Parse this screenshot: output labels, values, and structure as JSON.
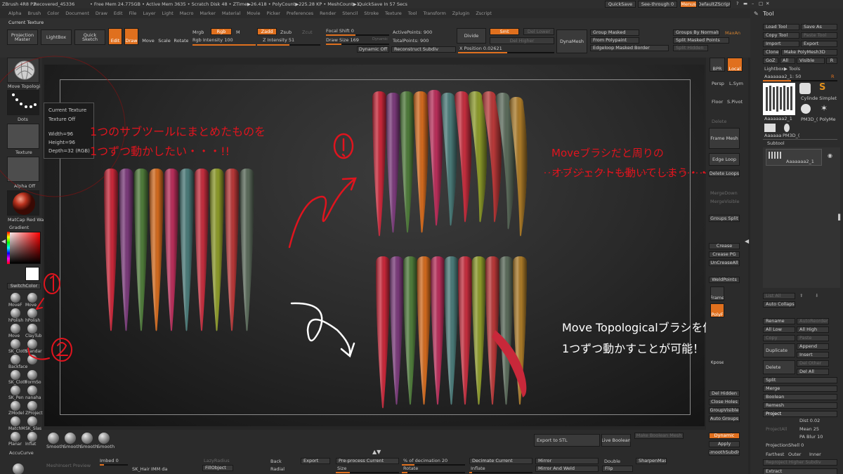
{
  "topbar": {
    "title": "ZBrush 4R8 P2",
    "file": "Recovered_45336",
    "stats": "• Free Mem 24.775GB • Active Mem 3635 • Scratch Disk 48 • ZTime▶26.418 • PolyCount▶225.28 KP • MeshCount▶1",
    "quicksave_note": "QuickSave In 57 Secs",
    "quicksave": "QuickSave",
    "seethrough": "See-through  0",
    "menus": "Menus",
    "defaultzscript": "DefaultZScript"
  },
  "menu": [
    "Alpha",
    "Brush",
    "Color",
    "Document",
    "Draw",
    "Edit",
    "File",
    "Layer",
    "Light",
    "Macro",
    "Marker",
    "Material",
    "Movie",
    "Picker",
    "Preferences",
    "Render",
    "Stencil",
    "Stroke",
    "Texture",
    "Tool",
    "Transform",
    "Zplugin",
    "Zscript"
  ],
  "shelf": {
    "current_texture": "Current Texture",
    "projection_master": "Projection Master",
    "lightbox": "LightBox",
    "quick_sketch": "Quick Sketch",
    "edit": "Edit",
    "draw": "Draw",
    "move": "Move",
    "scale": "Scale",
    "rotate": "Rotate",
    "mrgb": "Mrgb",
    "rgb": "Rgb",
    "m": "M",
    "rgb_intensity": "Rgb Intensity 100",
    "zadd": "Zadd",
    "zsub": "Zsub",
    "zcut": "Zcut",
    "z_intensity": "Z Intensity 51",
    "focal_shift": "Focal Shift 0",
    "draw_size": "Draw Size 169",
    "dynamic_small": "Dynamic",
    "dynamic_off": "Dynamic Off",
    "active_points": "ActivePoints: 900",
    "total_points": "TotalPoints: 900",
    "reconstruct_subdiv": "Reconstruct Subdiv",
    "divide": "Divide",
    "smt": "Smt",
    "del_lower": "Del Lower",
    "del_higher": "Del Higher",
    "x_position": "X Position 0.02621",
    "dynamesh": "DynaMesh",
    "group_masked": "Group Masked",
    "from_polypaint": "From Polypaint",
    "edgeloop_masked_border": "Edgeloop Masked Border",
    "groups_by_normals": "Groups By Normals",
    "maxan": "MaxAn",
    "split_masked_points": "Split Masked Points",
    "split_hidden": "Split Hidden"
  },
  "left": {
    "brush_thumb": "Move Topologi",
    "stroke_thumb": "Dots",
    "texture_thumb": "Texture",
    "alpha_thumb": "Alpha Off",
    "material_thumb": "MatCap Red Wa",
    "gradient": "Gradient",
    "switchcolor": "SwitchColor",
    "brushes": [
      "MoveF",
      "Move",
      "hPolish",
      "hPolish",
      "Move",
      "ClayTub",
      "SK_Cloth",
      "Standar",
      "Backface",
      "",
      "SK_Cloth",
      "FormSo",
      "SK_Pen",
      "nanaha",
      "ZModel",
      "ZProject",
      "MatchM",
      "SK_Slas",
      "Planar",
      "Inflat"
    ],
    "accucurve": "AccuCurve",
    "tooltip_title": "Current Texture",
    "tooltip_state": "Texture Off",
    "tooltip_width": "Width=96",
    "tooltip_height": "Height=96",
    "tooltip_depth": "Depth=32 (RGB)"
  },
  "rightshelf": {
    "bpr": "BPR",
    "local": "Local",
    "persp": "Persp",
    "lsym": "L.Sym",
    "floor": "Floor",
    "spivot": "S.Pivot",
    "delete": "Delete",
    "frame_mesh": "Frame Mesh",
    "edge_loop": "Edge Loop",
    "delete_loops": "Delete Loops",
    "merge_down": "MergeDown",
    "merge_visible": "MergeVisible",
    "groups_split": "Groups Split",
    "crease": "Crease",
    "crease_pg": "Crease PG",
    "uncrease_all": "UnCreaseAll",
    "weld_points": "WeldPoints",
    "frame": "Frame",
    "polyf": "PolyF",
    "xpose": "Xpose",
    "del_hidden": "Del Hidden",
    "close_holes": "Close Holes",
    "group_visible": "GroupVisible",
    "auto_groups": "Auto Groups",
    "dynamic": "Dynamic",
    "apply": "Apply",
    "smooth_subdiv": "SmoothSubdiv"
  },
  "bottom": {
    "smooth": [
      "Smooth",
      "Smooth",
      "Smooth",
      "Smooth"
    ],
    "imbed": "Imbed 0",
    "sk_hair": "SK_Hair IMM da",
    "lazymouse": "LazyRadius",
    "fill_object": "FillObject",
    "back": "Back",
    "radial": "Radial",
    "export": "Export",
    "preprocess_current": "Pre-process Current",
    "size": "Size",
    "pct_decimation": "% of decimation 20",
    "rotate": "Rotate",
    "decimate_current": "Decimate Current",
    "inflate": "Inflate",
    "mirror": "Mirror",
    "mirror_and_weld": "Mirror And Weld",
    "double": "Double",
    "flip": "Flip",
    "sharpen_mask": "SharpenMask",
    "export_to_stl": "Export to STL",
    "live_boolean": "Live Boolean",
    "make_boolean_mesh": "Make Boolean Mesh",
    "mesh_insert_preview": "MeshInsert Preview"
  },
  "tooltray": {
    "title": "Tool",
    "load_tool": "Load Tool",
    "save_as": "Save As",
    "copy_tool": "Copy Tool",
    "paste_tool": "Paste Tool",
    "import": "Import",
    "export": "Export",
    "clone": "Clone",
    "make_polymesh3d": "Make PolyMesh3D",
    "goz": "GoZ",
    "all": "All",
    "visible": "Visible",
    "r": "R",
    "lightbox_tools": "Lightbox▶ Tools",
    "current_tool": "Aaaaaaa2_1: 50",
    "tool_names": [
      "Aaaaaaa2_1",
      "Cylinde Simplet",
      "PM3D_( PolyMe",
      "Aaaaaa",
      "PM3D_("
    ],
    "subtool": "Subtool",
    "subtool_item": "Aaaaaaa2_1",
    "list_all": "List All",
    "auto_collapse": "Auto Collapse",
    "rename": "Rename",
    "autoreorder": "AutoReorder",
    "all_low": "All Low",
    "all_high": "All High",
    "copy": "Copy",
    "paste": "Paste",
    "duplicate": "Duplicate",
    "append": "Append",
    "insert": "Insert",
    "delete": "Delete",
    "del_other": "Del Other",
    "del_all": "Del All",
    "split": "Split",
    "merge": "Merge",
    "boolean": "Boolean",
    "remesh": "Remesh",
    "project": "Project",
    "project_all": "ProjectAll",
    "dist": "Dist 0.02",
    "mean": "Mean 25",
    "pa_blur": "PA Blur 10",
    "projection_shell": "ProjectionShell 0",
    "farthest": "Farthest",
    "outer": "Outer",
    "inner": "Inner",
    "reproject_higher": "Reproject Higher Subdiv",
    "extract": "Extract"
  },
  "notes": {
    "top_left_1": "1つのサブツールにまとめたものを",
    "top_left_2": "1つずつ動かしたい・・・!!",
    "circle_1": "①",
    "circle_2": "②",
    "right_1": "Moveブラシだと周りの",
    "right_2": "オブジェクトも動いてしまう・・・",
    "bottom_1": "Move Topologicalブラシを使うと",
    "bottom_2": "1つずつ動かすことが可能！",
    "left_1": "①",
    "left_2": "②"
  },
  "colors": {
    "accent": "#e0701e",
    "note_red": "#e0141e",
    "note_white": "#ffffff"
  }
}
